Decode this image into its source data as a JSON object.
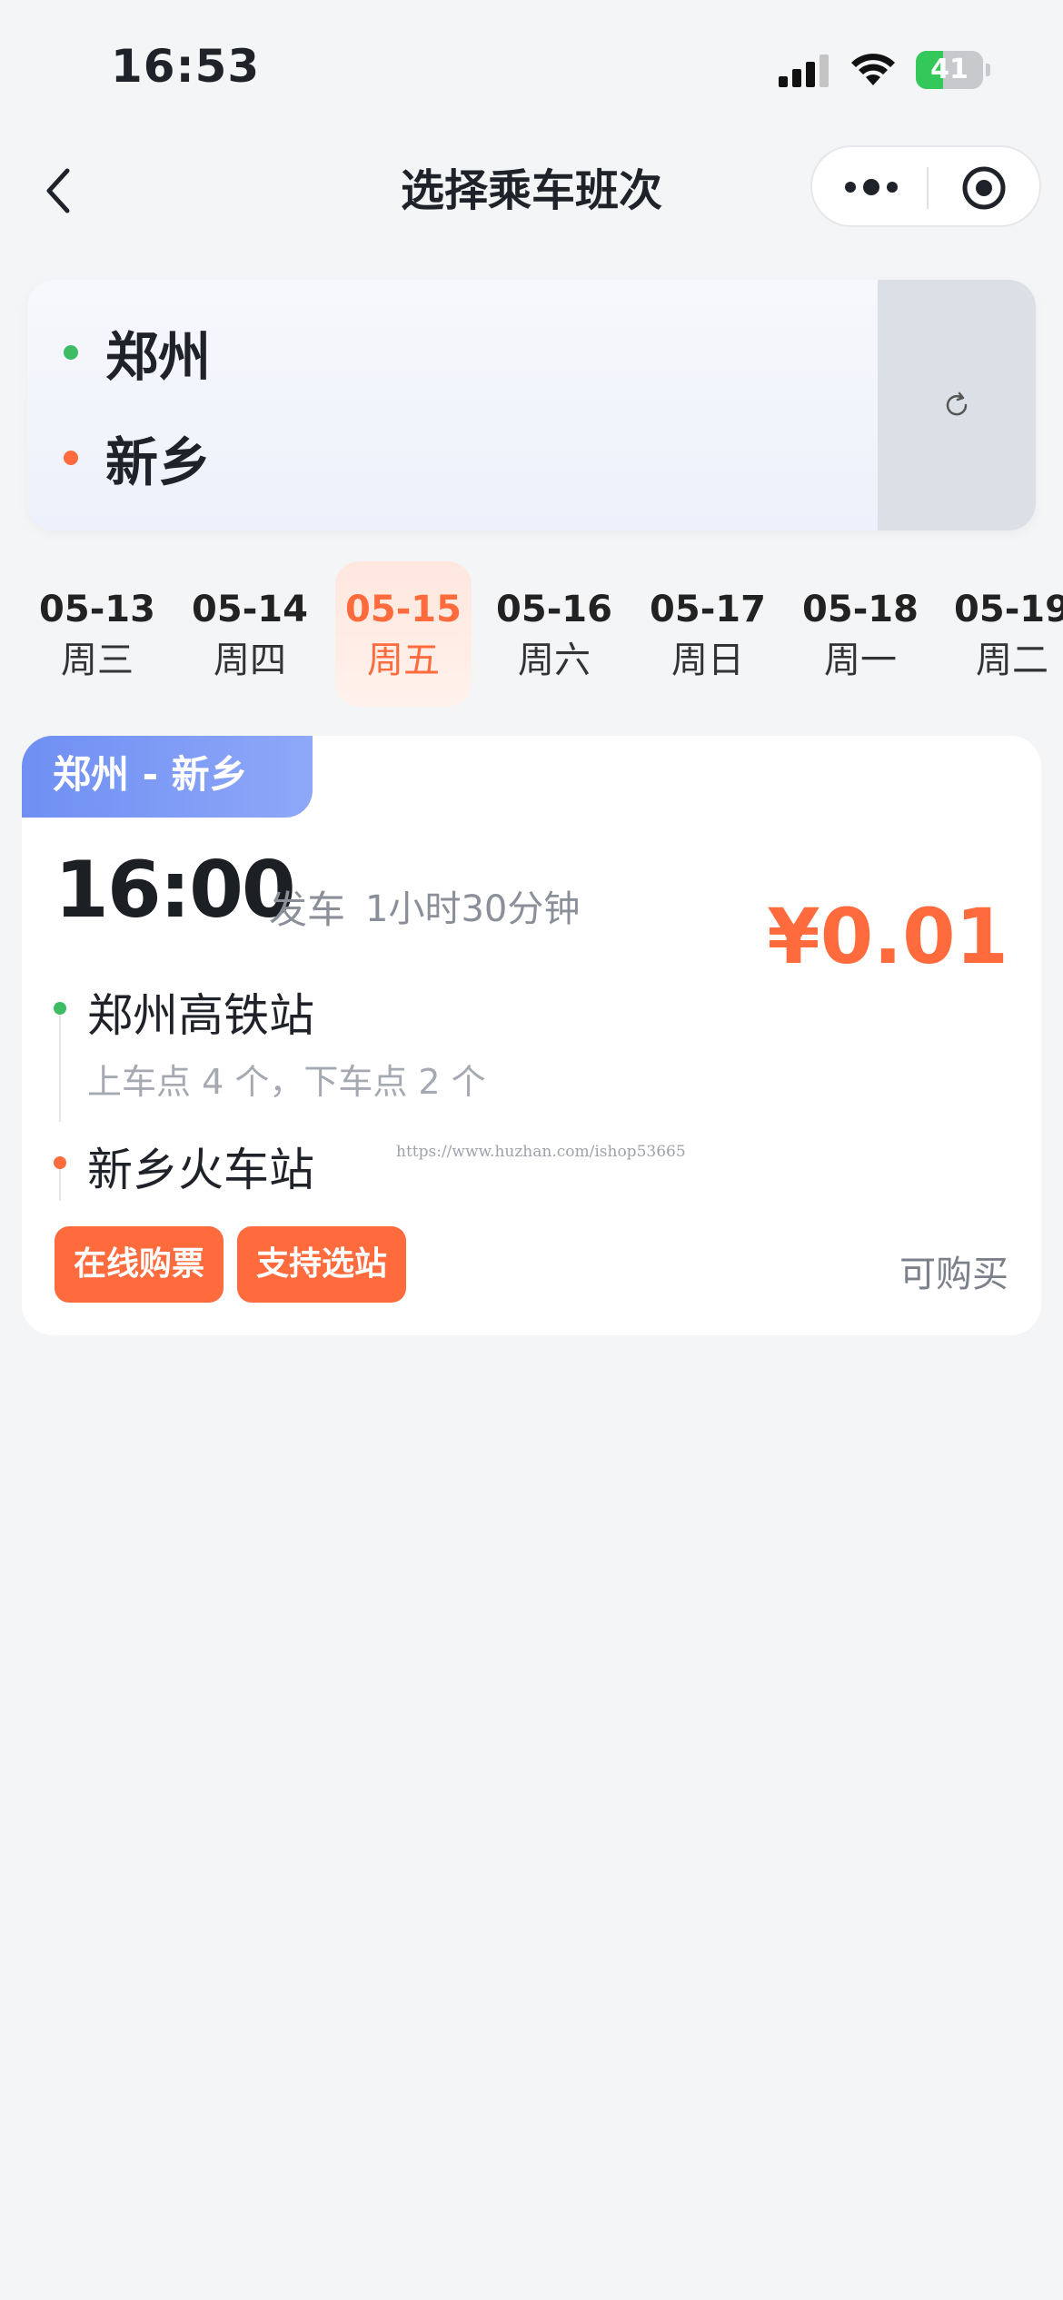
{
  "status_bar": {
    "time": "16:53",
    "battery": "41",
    "battery_level": 0.41,
    "icons": [
      "signal-icon",
      "wifi-icon",
      "battery-icon"
    ]
  },
  "nav": {
    "title": "选择乘车班次",
    "icons": [
      "back-icon",
      "more-icon",
      "target-icon"
    ]
  },
  "route": {
    "from": "郑州",
    "to": "新乡",
    "swap_icon": "swap-icon"
  },
  "dates": [
    {
      "md": "05-13",
      "wd": "周三"
    },
    {
      "md": "05-14",
      "wd": "周四"
    },
    {
      "md": "05-15",
      "wd": "周五"
    },
    {
      "md": "05-16",
      "wd": "周六"
    },
    {
      "md": "05-17",
      "wd": "周日"
    },
    {
      "md": "05-18",
      "wd": "周一"
    },
    {
      "md": "05-19",
      "wd": "周二"
    }
  ],
  "selected_date": "05-15",
  "trip": {
    "route_tag": "郑州 - 新乡",
    "depart_time": "16:00",
    "depart_label": "发车",
    "duration": "1小时30分钟",
    "price": "¥0.01",
    "from_station": "郑州高铁站",
    "stops_info": "上车点 4 个，下车点 2 个",
    "to_station": "新乡火车站",
    "watermark": "https://www.huzhan.com/ishop53665",
    "badges": [
      "在线购票",
      "支持选站"
    ],
    "status": "可购买"
  },
  "colors": {
    "accent": "#ff6b3d",
    "green": "#3ebc63",
    "tag_blue": "#6f8ff3",
    "background": "#f4f5f7"
  }
}
